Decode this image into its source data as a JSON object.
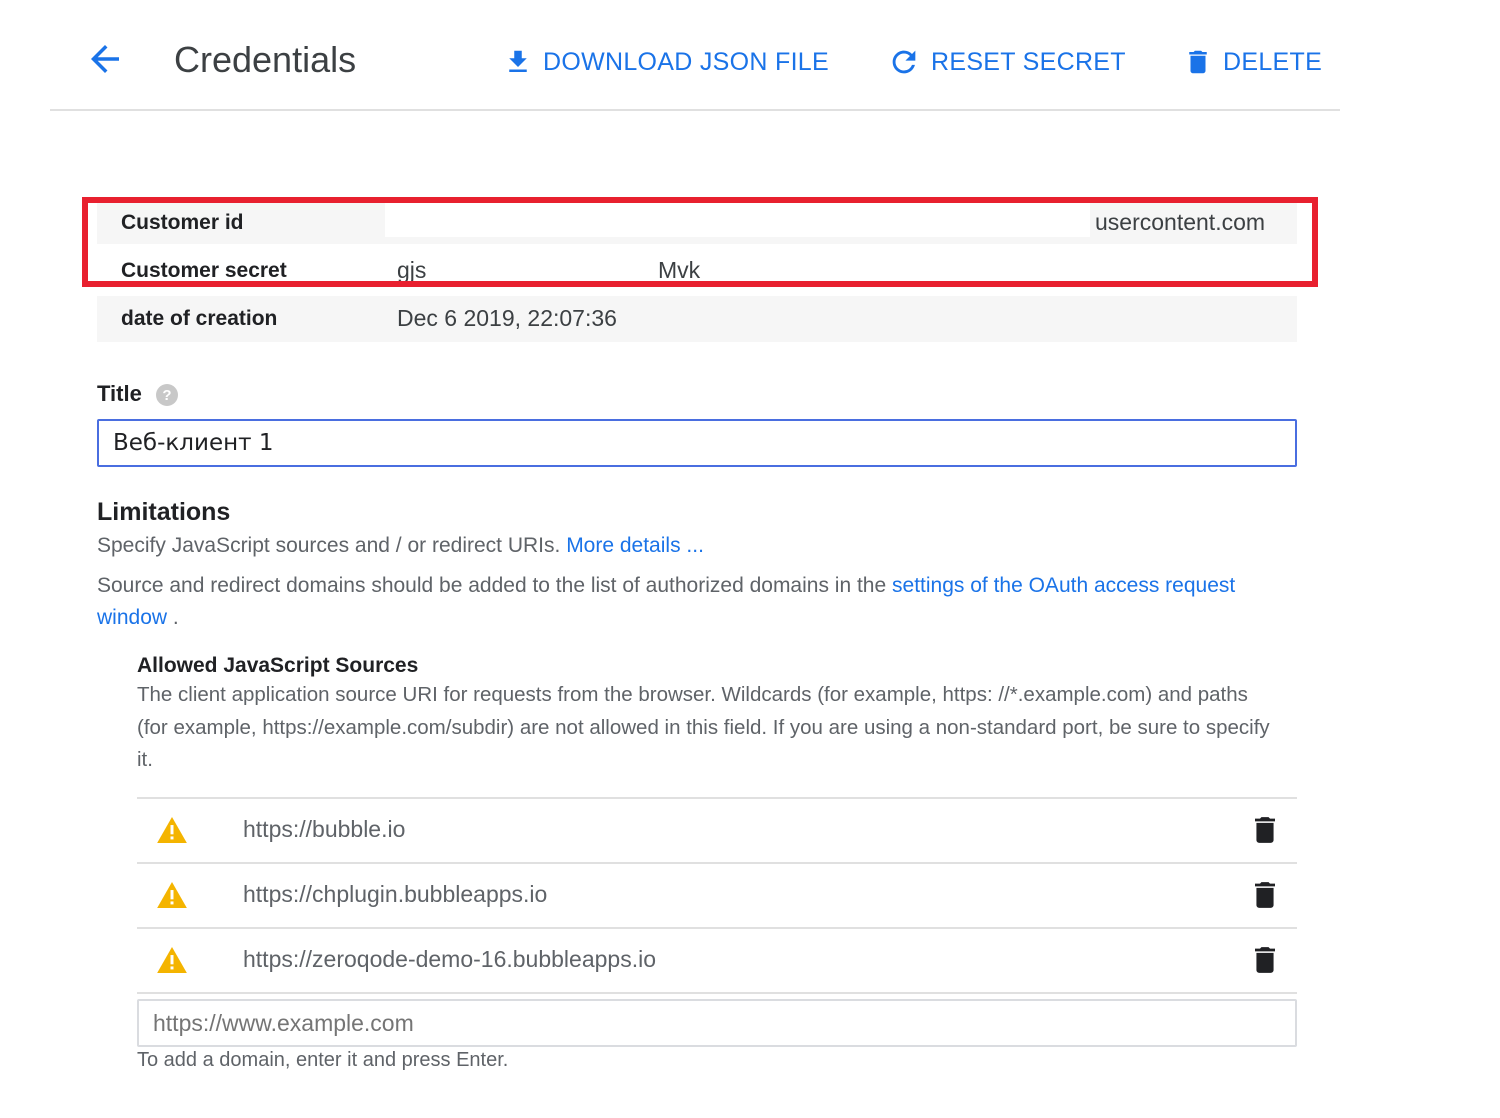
{
  "header": {
    "title": "Credentials",
    "actions": {
      "download_label": "DOWNLOAD JSON FILE",
      "reset_label": "RESET SECRET",
      "delete_label": "DELETE"
    }
  },
  "info": {
    "customer_id": {
      "label": "Customer id",
      "value": "usercontent.com"
    },
    "customer_secret": {
      "label": "Customer secret",
      "value_start": "gjs",
      "value_end": "Mvk"
    },
    "created": {
      "label": "date of creation",
      "value": "Dec 6 2019, 22:07:36"
    }
  },
  "title_field": {
    "label": "Title",
    "value": "Веб-клиент 1"
  },
  "limitations": {
    "heading": "Limitations",
    "line1_text": "Specify JavaScript sources and / or redirect URIs.",
    "line1_link": "More details ...",
    "line2_text": "Source and redirect domains should be added to the list of authorized domains in the",
    "line2_link": "settings of the OAuth access request window",
    "line2_end": " ."
  },
  "js_sources": {
    "heading": "Allowed JavaScript Sources",
    "description": "The client application source URI for requests from the browser. Wildcards (for example, https: //*.example.com) and paths (for example, https://example.com/subdir) are not allowed in this field. If you are using a non-standard port, be sure to specify it.",
    "items": [
      {
        "uri": "https://bubble.io",
        "icon": "warning-icon"
      },
      {
        "uri": "https://chplugin.bubbleapps.io",
        "icon": "warning-icon"
      },
      {
        "uri": "https://zeroqode-demo-16.bubbleapps.io",
        "icon": "warning-icon"
      }
    ],
    "input_placeholder": "https://www.example.com",
    "hint": "To add a domain, enter it and press Enter."
  },
  "colors": {
    "accent": "#1a73e8",
    "highlight_border": "#e8202f",
    "warning": "#f4b400",
    "focus_border": "#4a6ee0"
  }
}
